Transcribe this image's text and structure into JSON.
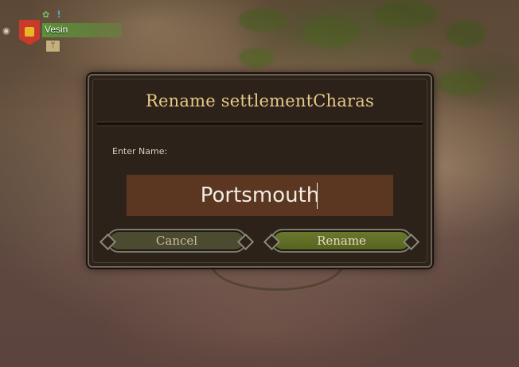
{
  "party": {
    "name": "Vesin",
    "troop_icon": "ᛘ",
    "status_icon": "!"
  },
  "dialog": {
    "title": "Rename settlementCharas",
    "label": "Enter Name:",
    "input_value": "Portsmouth",
    "cancel_label": "Cancel",
    "rename_label": "Rename"
  },
  "colors": {
    "title": "#e9c98a",
    "input_bg": "#5b3722",
    "rename_button": "#6b7a2e",
    "cancel_button": "#4c4a31"
  },
  "icons": [
    "eye-icon",
    "party-banner-icon",
    "clan-icon",
    "quest-alert-icon",
    "troop-icon"
  ]
}
